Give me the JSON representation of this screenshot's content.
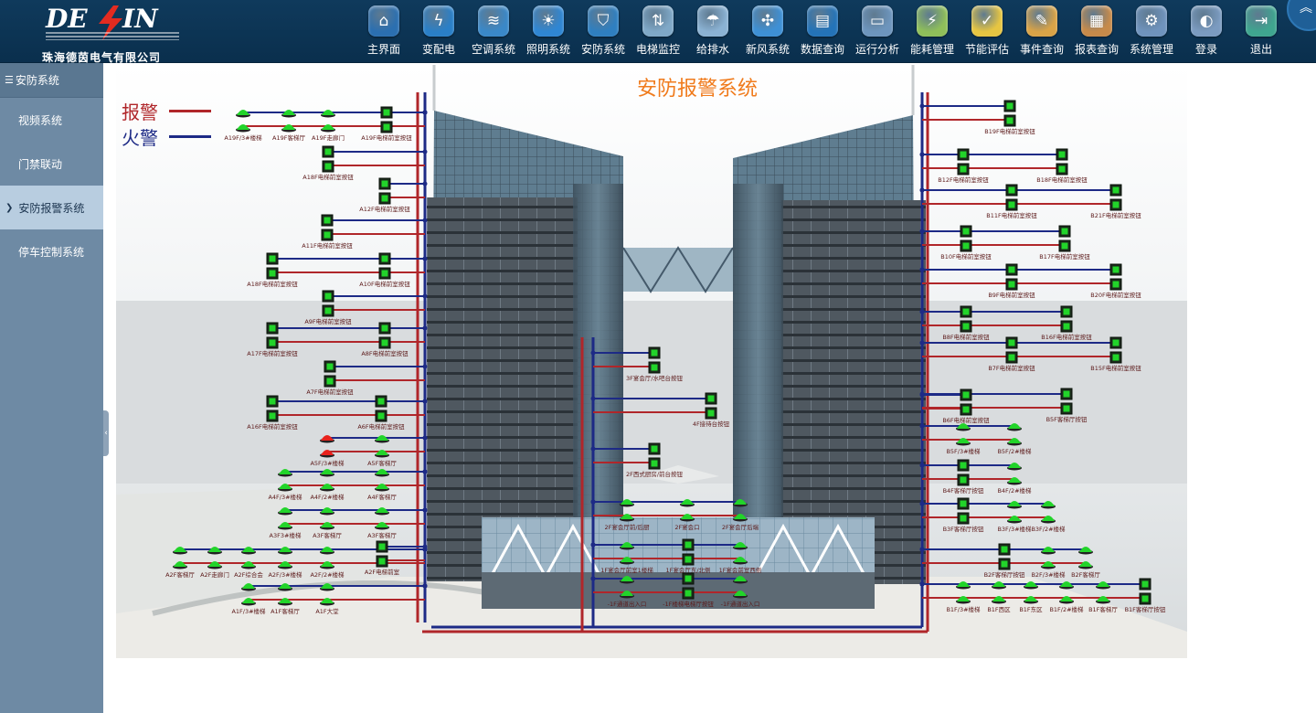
{
  "logo": {
    "brand": "DE  IN",
    "company": "珠海德茵电气有限公司"
  },
  "nav": [
    {
      "label": "主界面",
      "icon": "home-icon",
      "color": "#2b6fb0"
    },
    {
      "label": "变配电",
      "icon": "power-distribution-icon",
      "color": "#2a7fc7"
    },
    {
      "label": "空调系统",
      "icon": "air-conditioner-icon",
      "color": "#3a88c8"
    },
    {
      "label": "照明系统",
      "icon": "lightbulb-icon",
      "color": "#2f86d3"
    },
    {
      "label": "安防系统",
      "icon": "shield-icon",
      "color": "#2f7fc0"
    },
    {
      "label": "电梯监控",
      "icon": "elevator-icon",
      "color": "#7fa8c7"
    },
    {
      "label": "给排水",
      "icon": "water-drop-icon",
      "color": "#8bb2d3"
    },
    {
      "label": "新风系统",
      "icon": "fan-icon",
      "color": "#3e90d5"
    },
    {
      "label": "数据查询",
      "icon": "data-chart-icon",
      "color": "#2473b8"
    },
    {
      "label": "运行分析",
      "icon": "monitor-icon",
      "color": "#6d95bd"
    },
    {
      "label": "能耗管理",
      "icon": "energy-icon",
      "color": "#8fbf5a"
    },
    {
      "label": "节能评估",
      "icon": "checklist-icon",
      "color": "#e6c542"
    },
    {
      "label": "事件查询",
      "icon": "pencil-icon",
      "color": "#d9a347"
    },
    {
      "label": "报表查询",
      "icon": "report-icon",
      "color": "#c68a4a"
    },
    {
      "label": "系统管理",
      "icon": "gears-icon",
      "color": "#6f93bd"
    },
    {
      "label": "登录",
      "icon": "login-icon",
      "color": "#7b9bc0"
    },
    {
      "label": "退出",
      "icon": "exit-icon",
      "color": "#3fa58f"
    }
  ],
  "sidebar": {
    "title": "安防系统",
    "items": [
      "视频系统",
      "门禁联动",
      "安防报警系统",
      "停车控制系统"
    ],
    "active_index": 2
  },
  "scene": {
    "title": "安防报警系统",
    "legend": [
      {
        "label": "报警",
        "color": "#b0262a"
      },
      {
        "label": "火警",
        "color": "#1d2a86"
      }
    ]
  },
  "colors": {
    "alarm": "#b0262a",
    "fire": "#1d2a86",
    "device_green": "#22d42a",
    "device_red": "#e8221c",
    "title_orange": "#f07b1c"
  },
  "devices": {
    "left": [
      {
        "label": "A19F/3#楼梯"
      },
      {
        "label": "A19F客梯厅"
      },
      {
        "label": "A19F走廊门"
      },
      {
        "label": "A19F电梯前室按钮"
      },
      {
        "label": "A18F电梯前室按钮"
      },
      {
        "label": "A12F电梯前室按钮"
      },
      {
        "label": "A11F电梯前室按钮"
      },
      {
        "label": "A10F电梯前室按钮"
      },
      {
        "label": "A18F电梯前室按钮"
      },
      {
        "label": "A9F电梯前室按钮"
      },
      {
        "label": "A17F电梯前室按钮"
      },
      {
        "label": "A8F电梯前室按钮"
      },
      {
        "label": "A7F电梯前室按钮"
      },
      {
        "label": "A16F电梯前室按钮"
      },
      {
        "label": "A6F电梯前室按钮"
      },
      {
        "label": "A5F/3#楼梯"
      },
      {
        "label": "A5F客梯厅"
      },
      {
        "label": "A4F/3#楼梯"
      },
      {
        "label": "A4F/2#楼梯"
      },
      {
        "label": "A4F客梯厅"
      },
      {
        "label": "A3F3#楼梯"
      },
      {
        "label": "A3F客梯厅"
      },
      {
        "label": "A3F客梯厅"
      },
      {
        "label": "A2F客梯厅"
      },
      {
        "label": "A2F走廊门"
      },
      {
        "label": "A2F综合会"
      },
      {
        "label": "A2F/3#楼梯"
      },
      {
        "label": "A2F/2#楼梯"
      },
      {
        "label": "A2F电梯前室"
      },
      {
        "label": "A1F/3#楼梯"
      },
      {
        "label": "A1F客梯厅"
      },
      {
        "label": "A1F大堂"
      }
    ],
    "center": [
      {
        "label": "3F宴会厅/水吧台按钮"
      },
      {
        "label": "4F接待台按钮"
      },
      {
        "label": "2F西式厨房/前台按钮"
      },
      {
        "label": "2F宴会厅前/后厨"
      },
      {
        "label": "2F宴会口"
      },
      {
        "label": "2F宴会厅后端"
      },
      {
        "label": "1F宴会厅前室1楼梯"
      },
      {
        "label": "1F宴会厅东/北侧"
      },
      {
        "label": "1F宴会前室西侧"
      },
      {
        "label": "-1F通道出入口"
      },
      {
        "label": "-1F楼梯电梯厅按钮"
      },
      {
        "label": "-1F通道出入口"
      }
    ],
    "right": [
      {
        "label": "B19F电梯前室按钮"
      },
      {
        "label": "B12F电梯前室按钮"
      },
      {
        "label": "B18F电梯前室按钮"
      },
      {
        "label": "B11F电梯前室按钮"
      },
      {
        "label": "B21F电梯前室按钮"
      },
      {
        "label": "B10F电梯前室按钮"
      },
      {
        "label": "B17F电梯前室按钮"
      },
      {
        "label": "B9F电梯前室按钮"
      },
      {
        "label": "B20F电梯前室按钮"
      },
      {
        "label": "B8F电梯前室按钮"
      },
      {
        "label": "B16F电梯前室按钮"
      },
      {
        "label": "B7F电梯前室按钮"
      },
      {
        "label": "B15F电梯前室按钮"
      },
      {
        "label": "B6F电梯前室按钮"
      },
      {
        "label": "B5F客梯厅按钮"
      },
      {
        "label": "B5F/3#楼梯"
      },
      {
        "label": "B5F/2#楼梯"
      },
      {
        "label": "B4F客梯厅按钮"
      },
      {
        "label": "B4F/2#楼梯"
      },
      {
        "label": "B3F客梯厅按钮"
      },
      {
        "label": "B3F/3#楼梯"
      },
      {
        "label": "B3F/2#楼梯"
      },
      {
        "label": "B2F客梯厅按钮"
      },
      {
        "label": "B2F/3#楼梯"
      },
      {
        "label": "B2F客梯厅"
      },
      {
        "label": "B1F/3#楼梯"
      },
      {
        "label": "B1F西区"
      },
      {
        "label": "B1F东区"
      },
      {
        "label": "B1F/2#楼梯"
      },
      {
        "label": "B1F客梯厅"
      },
      {
        "label": "B1F客梯厅按钮"
      }
    ]
  }
}
